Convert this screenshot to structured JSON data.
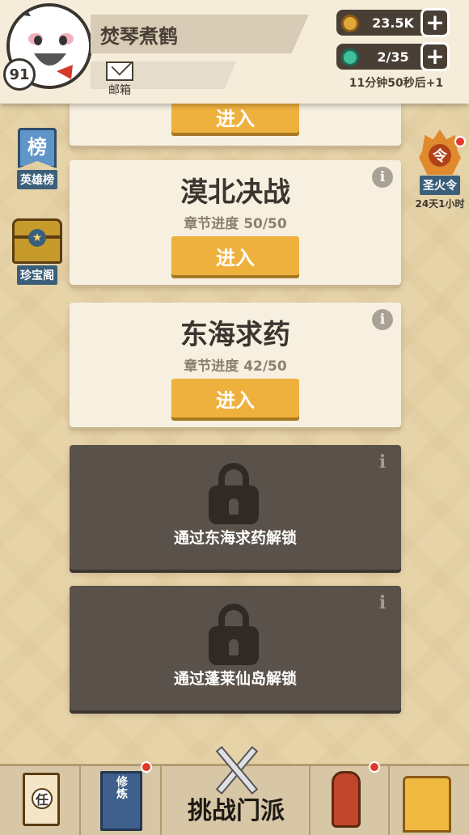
{
  "player": {
    "name": "焚琴煮鹤",
    "level": "91",
    "mail_label": "邮箱"
  },
  "resources": {
    "coins": "23.5K",
    "stamina": "2/35",
    "timer": "11分钟50秒后+1"
  },
  "side_left": {
    "rank_icon_char": "榜",
    "rank_label": "英雄榜",
    "treasure_label": "珍宝阁"
  },
  "side_right": {
    "fire_char": "令",
    "fire_label": "圣火令",
    "fire_time": "24天1小时"
  },
  "chapters": [
    {
      "enter_label": "进入"
    },
    {
      "title": "漠北决战",
      "progress_label": "章节进度",
      "progress": "50/50",
      "enter_label": "进入"
    },
    {
      "title": "东海求药",
      "progress_label": "章节进度",
      "progress": "42/50",
      "enter_label": "进入"
    },
    {
      "unlock_text": "通过东海求药解锁"
    },
    {
      "unlock_text": "通过蓬莱仙岛解锁"
    }
  ],
  "info_glyph": "i",
  "bottom_nav": {
    "task_char": "任",
    "train_label": "修炼",
    "challenge_label": "挑战门派"
  },
  "colors": {
    "accent": "#efb13d",
    "card": "#f7f0e0",
    "locked": "#5a524a",
    "background": "#e6d3a8"
  },
  "icons": [
    "coin-icon",
    "jade-icon",
    "plus-icon",
    "mail-icon",
    "info-icon",
    "lock-icon",
    "rank-flag-icon",
    "treasure-chest-icon",
    "fire-badge-icon",
    "scroll-icon",
    "book-icon",
    "swords-icon",
    "bottle-icon"
  ]
}
